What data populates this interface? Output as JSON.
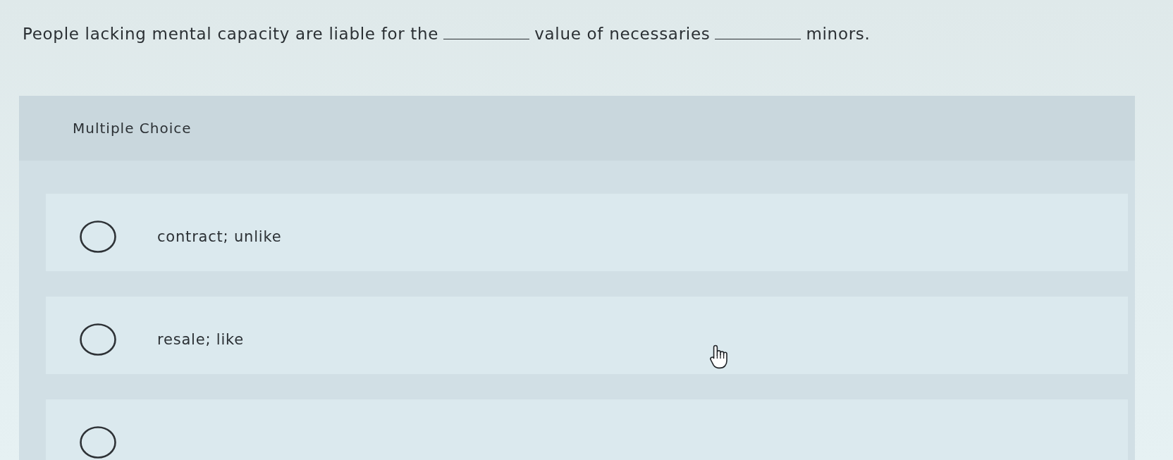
{
  "question": {
    "parts": [
      {
        "kind": "text",
        "text": "People lacking mental capacity are liable for the"
      },
      {
        "kind": "blank"
      },
      {
        "kind": "text",
        "text": "value of necessaries"
      },
      {
        "kind": "blank"
      },
      {
        "kind": "text",
        "text": "minors."
      }
    ]
  },
  "answer_panel": {
    "heading": "Multiple Choice",
    "options": [
      {
        "label": "contract; unlike",
        "selected": false
      },
      {
        "label": "resale; like",
        "selected": false
      },
      {
        "selected": false
      }
    ]
  }
}
